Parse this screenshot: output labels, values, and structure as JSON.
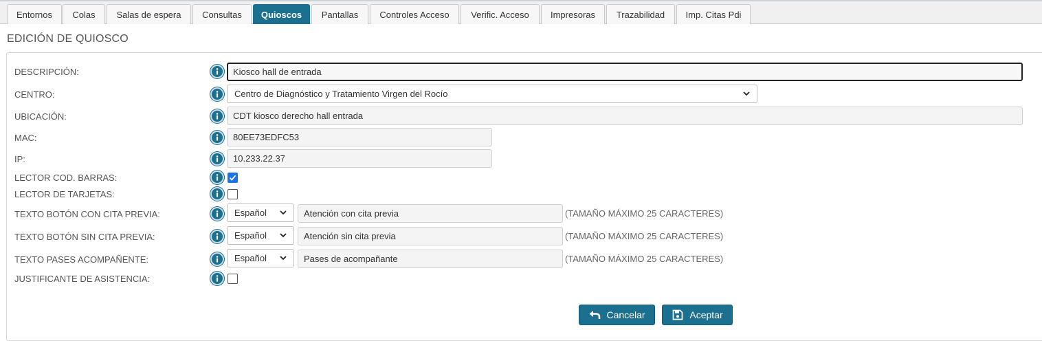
{
  "tabs": [
    {
      "label": "Entornos",
      "active": false
    },
    {
      "label": "Colas",
      "active": false
    },
    {
      "label": "Salas de espera",
      "active": false
    },
    {
      "label": "Consultas",
      "active": false
    },
    {
      "label": "Quioscos",
      "active": true
    },
    {
      "label": "Pantallas",
      "active": false
    },
    {
      "label": "Controles Acceso",
      "active": false
    },
    {
      "label": "Verific. Acceso",
      "active": false
    },
    {
      "label": "Impresoras",
      "active": false
    },
    {
      "label": "Trazabilidad",
      "active": false
    },
    {
      "label": "Imp. Citas Pdi",
      "active": false
    }
  ],
  "page_title": "EDICIÓN DE QUIOSCO",
  "form": {
    "descripcion": {
      "label": "DESCRIPCIÓN:",
      "value": "Kiosco hall de entrada"
    },
    "centro": {
      "label": "CENTRO:",
      "value": "Centro de Diagnóstico y Tratamiento Virgen del Rocío"
    },
    "ubicacion": {
      "label": "UBICACIÓN:",
      "value": "CDT kiosco derecho hall entrada"
    },
    "mac": {
      "label": "MAC:",
      "value": "80EE73EDFC53"
    },
    "ip": {
      "label": "IP:",
      "value": "10.233.22.37"
    },
    "lector_cod_barras": {
      "label": "LECTOR COD. BARRAS:",
      "checked": true
    },
    "lector_tarjetas": {
      "label": "LECTOR DE TARJETAS:",
      "checked": false
    },
    "texto_con_cita": {
      "label": "TEXTO BOTÓN CON CITA PREVIA:",
      "language": "Español",
      "value": "Atención con cita previa",
      "hint": "(TAMAÑO MÁXIMO 25 CARACTERES)"
    },
    "texto_sin_cita": {
      "label": "TEXTO BOTÓN SIN CITA PREVIA:",
      "language": "Español",
      "value": "Atención sin cita previa",
      "hint": "(TAMAÑO MÁXIMO 25 CARACTERES)"
    },
    "texto_pases": {
      "label": "TEXTO PASES ACOMPAÑENTE:",
      "language": "Español",
      "value": "Pases de acompañante",
      "hint": "(TAMAÑO MÁXIMO 25 CARACTERES)"
    },
    "justificante": {
      "label": "JUSTIFICANTE DE ASISTENCIA:",
      "checked": false
    }
  },
  "buttons": {
    "cancel": {
      "label": "Cancelar",
      "icon": "undo-arrow-icon"
    },
    "accept": {
      "label": "Aceptar",
      "icon": "floppy-disk-icon"
    }
  },
  "colors": {
    "accent": "#1b6f8f",
    "checkbox_checked": "#1a73e8"
  }
}
